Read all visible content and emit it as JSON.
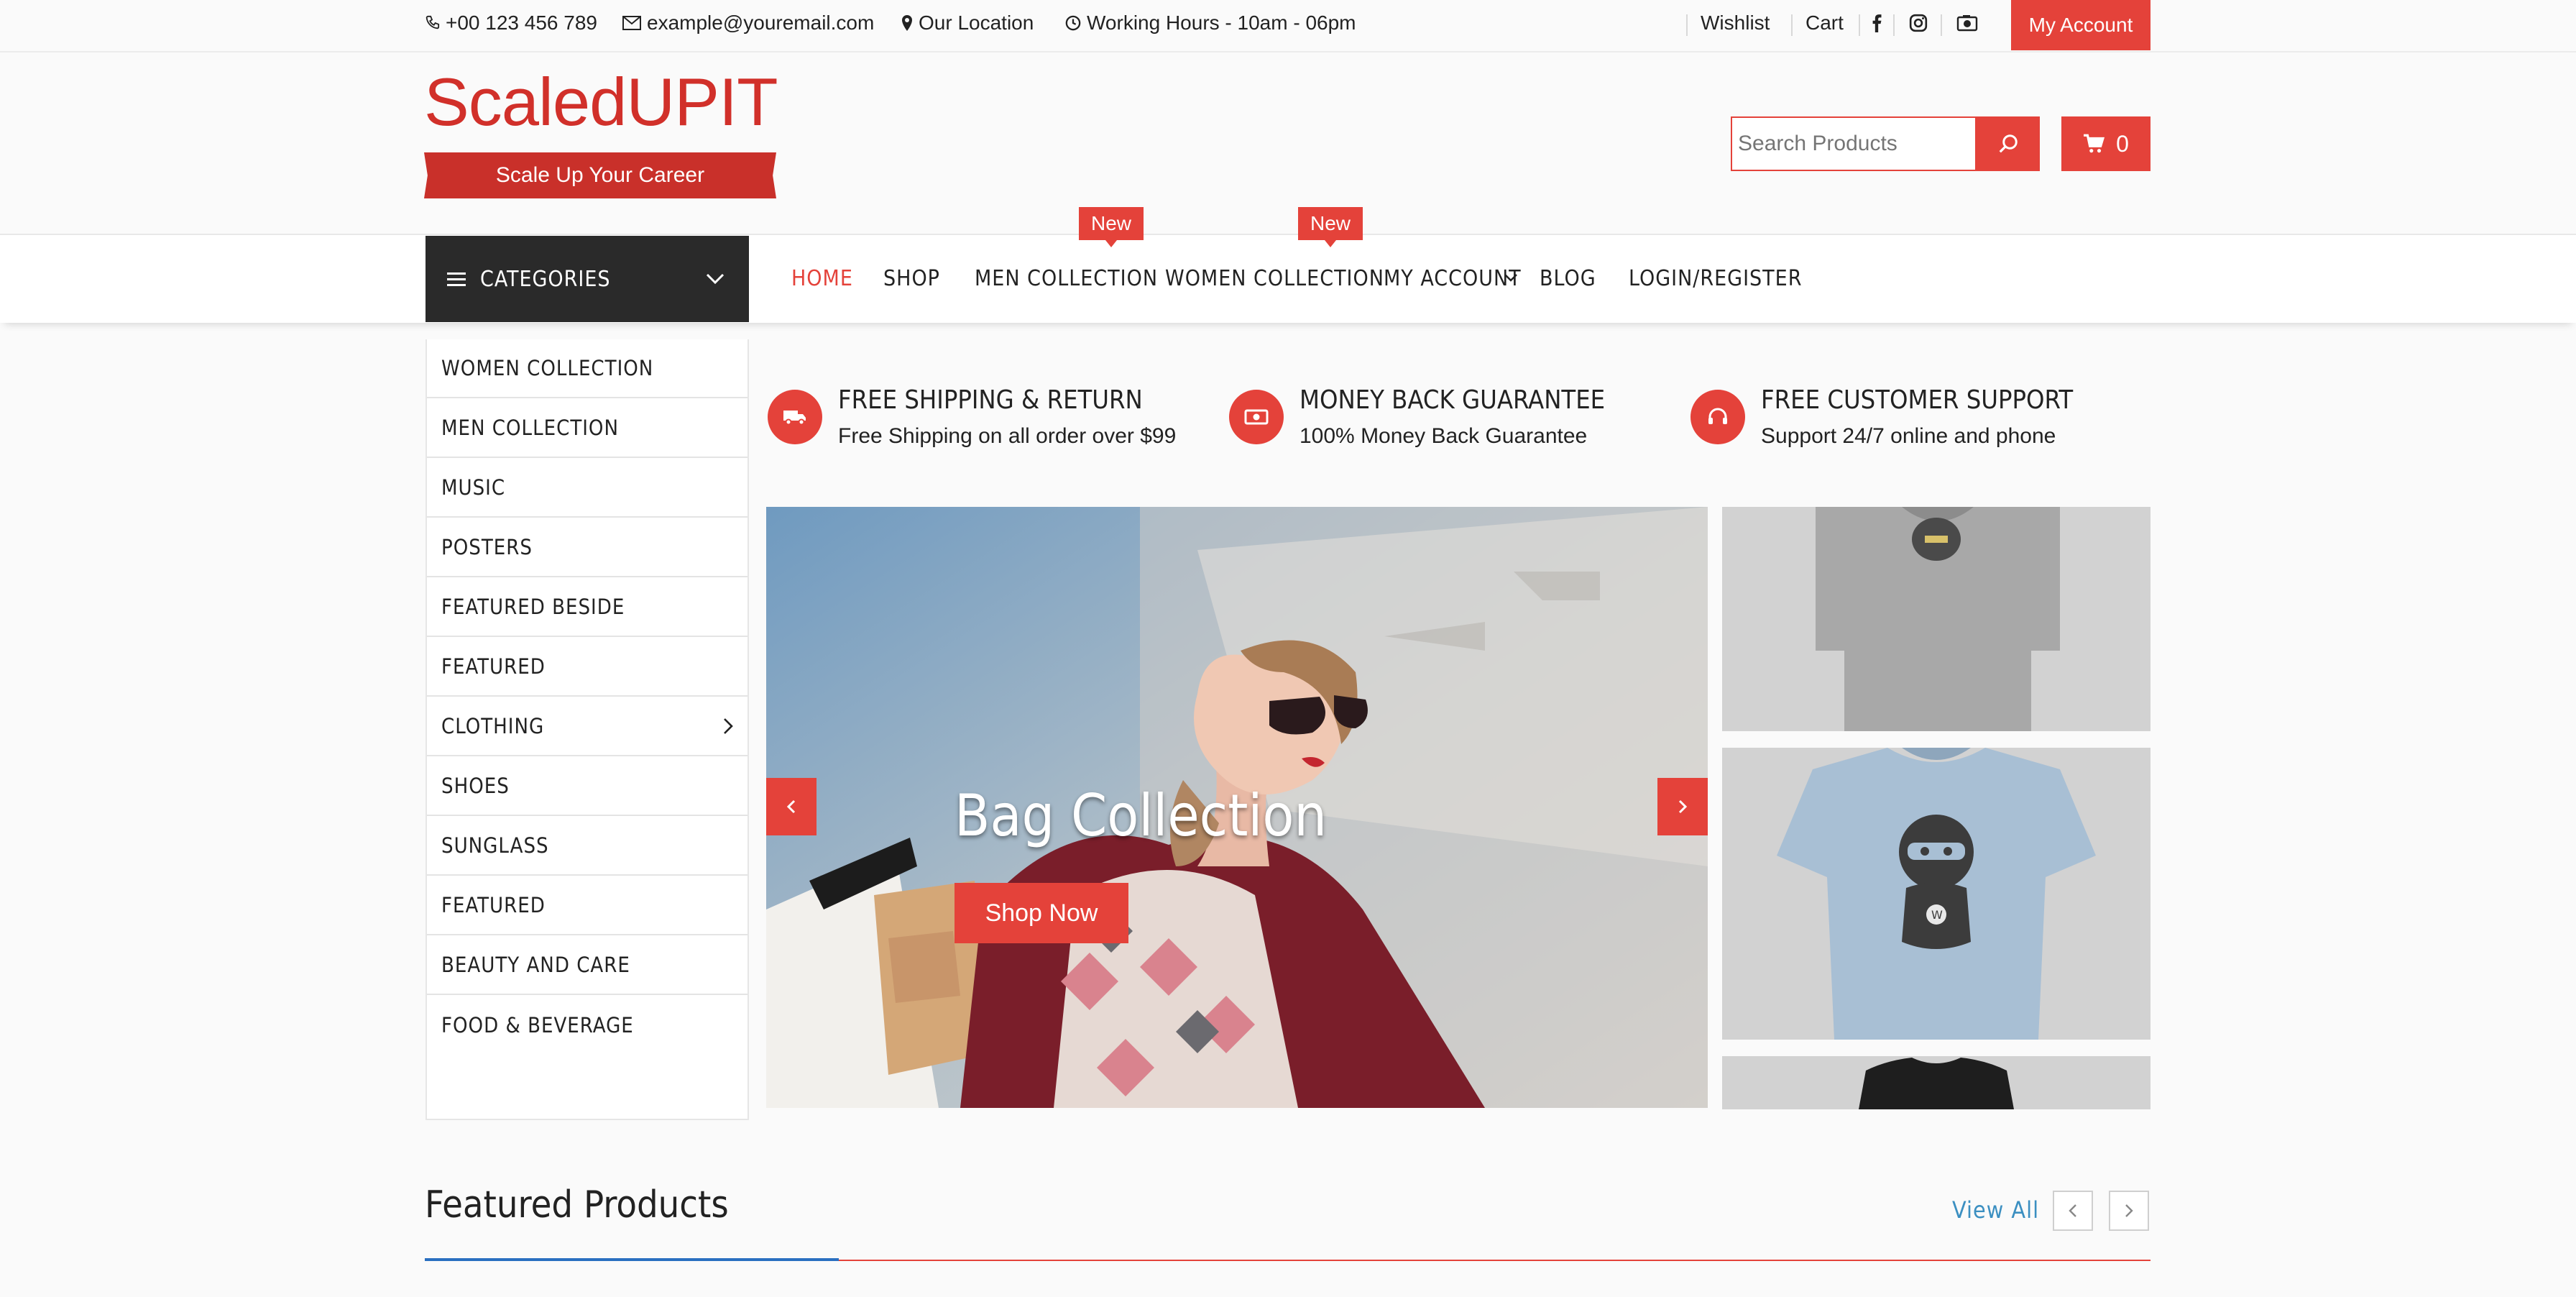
{
  "topbar": {
    "phone": "+00 123 456 789",
    "email": "example@youremail.com",
    "location": "Our Location",
    "hours": "Working Hours - 10am - 06pm",
    "wishlist": "Wishlist",
    "cart": "Cart",
    "my_account": "My Account",
    "social_icons": [
      "facebook-icon",
      "instagram-icon",
      "camera-icon"
    ]
  },
  "header": {
    "logo_text": "ScaledUPIT",
    "logo_tagline": "Scale Up Your Career",
    "search_placeholder": "Search Products",
    "cart_count": "0"
  },
  "nav": {
    "categories_label": "CATEGORIES",
    "links": [
      "HOME",
      "SHOP",
      "MEN COLLECTION",
      "WOMEN COLLECTION",
      "MY ACCOUNT",
      "BLOG",
      "LOGIN/REGISTER"
    ],
    "badges": [
      "New",
      "New"
    ]
  },
  "sidebar": {
    "items": [
      "WOMEN COLLECTION",
      "MEN COLLECTION",
      "MUSIC",
      "POSTERS",
      "FEATURED BESIDE",
      "FEATURED",
      "CLOTHING",
      "SHOES",
      "SUNGLASS",
      "FEATURED",
      "BEAUTY AND CARE",
      "FOOD & BEVERAGE"
    ]
  },
  "features": [
    {
      "title": "FREE SHIPPING & RETURN",
      "subtitle": "Free Shipping on all order over $99",
      "icon": "truck-icon"
    },
    {
      "title": "MONEY BACK GUARANTEE",
      "subtitle": "100% Money Back Guarantee",
      "icon": "money-icon"
    },
    {
      "title": "FREE CUSTOMER SUPPORT",
      "subtitle": "Support 24/7 online and phone",
      "icon": "headset-icon"
    }
  ],
  "slider": {
    "title": "Bag Collection",
    "button": "Shop Now"
  },
  "featured": {
    "title": "Featured Products",
    "view_all": "View All"
  },
  "colors": {
    "accent": "#e4423a",
    "dark": "#2a2a2a",
    "link_blue": "#3b8fc1"
  }
}
